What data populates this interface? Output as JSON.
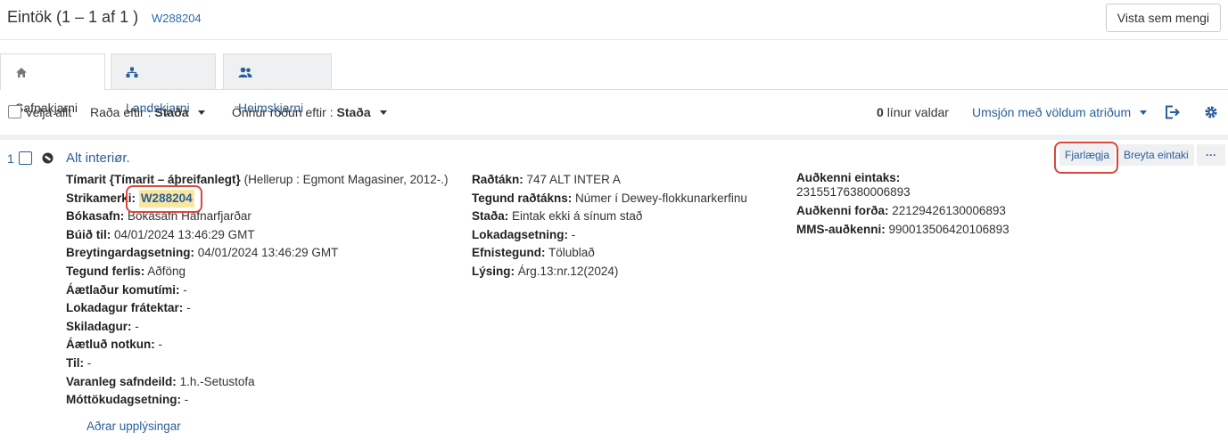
{
  "header": {
    "title": "Eintök (1 – 1 af 1 )",
    "barcode_link": "W288204",
    "view_as_set": "Vista sem mengi"
  },
  "tabs": [
    {
      "label": "Safnakjarni",
      "icon": "home-icon",
      "active": true
    },
    {
      "label": "Landskjarni",
      "icon": "network-icon",
      "active": false
    },
    {
      "label": "Heimskjarni",
      "icon": "users-icon",
      "active": false
    }
  ],
  "toolbar": {
    "select_all": "Velja allt",
    "sort_label": "Raða eftir :",
    "sort_value": "Staða",
    "secondary_sort_label": "Önnur röðun eftir :",
    "secondary_sort_value": "Staða",
    "selected_count": "0",
    "selected_label": "línur valdar",
    "manage_selected": "Umsjón með völdum atriðum"
  },
  "item": {
    "index": "1",
    "title": "Alt interiør.",
    "actions": {
      "remove": "Fjarlægja",
      "edit": "Breyta eintaki",
      "more": "···"
    },
    "col1": {
      "type_label": "Tímarit {Tímarit – áþreifanlegt}",
      "type_value": "(Hellerup : Egmont Magasiner, 2012-.)",
      "barcode_label": "Strikamerki",
      "barcode_value": "W288204",
      "library_label": "Bókasafn:",
      "library_value": "Bókasafn Hafnarfjarðar",
      "created_label": "Búið til:",
      "created_value": "04/01/2024 13:46:29 GMT",
      "modified_label": "Breytingardagsetning:",
      "modified_value": "04/01/2024 13:46:29 GMT",
      "loan_type_label": "Tegund ferlis:",
      "loan_type_value": "Aðföng",
      "expected_arrival_label": "Áætlaður komutími:",
      "expected_arrival_value": "-",
      "hold_end_label": "Lokadagur frátektar:",
      "hold_end_value": "-",
      "due_label": "Skiladagur:",
      "due_value": "-",
      "expected_use_label": "Áætluð notkun:",
      "expected_use_value": "-",
      "to_label": "Til:",
      "to_value": "-",
      "perm_location_label": "Varanleg safndeild:",
      "perm_location_value": "1.h.-Setustofa",
      "receive_date_label": "Móttökudagsetning:",
      "receive_date_value": "-"
    },
    "col2": {
      "callno_label": "Raðtákn:",
      "callno_value": "747 ALT INTER A",
      "callno_type_label": "Tegund raðtákns:",
      "callno_type_value": "Númer í Dewey-flokkunarkerfinu",
      "status_label": "Staða:",
      "status_value": "Eintak ekki á sínum stað",
      "end_date_label": "Lokadagsetning:",
      "end_date_value": "-",
      "material_label": "Efnistegund:",
      "material_value": "Tölublað",
      "description_label": "Lýsing:",
      "description_value": "Árg.13:nr.12(2024)"
    },
    "col3": {
      "item_id_label": "Auðkenni eintaks:",
      "item_id_value": "23155176380006893",
      "holding_id_label": "Auðkenni forða:",
      "holding_id_value": "22129426130006893",
      "mms_id_label": "MMS-auðkenni:",
      "mms_id_value": "990013506420106893"
    },
    "more_info": "Aðrar upplýsingar"
  },
  "colors": {
    "link": "#2a5e9b",
    "highlight": "#f9e79f",
    "ring": "#d9463b"
  }
}
